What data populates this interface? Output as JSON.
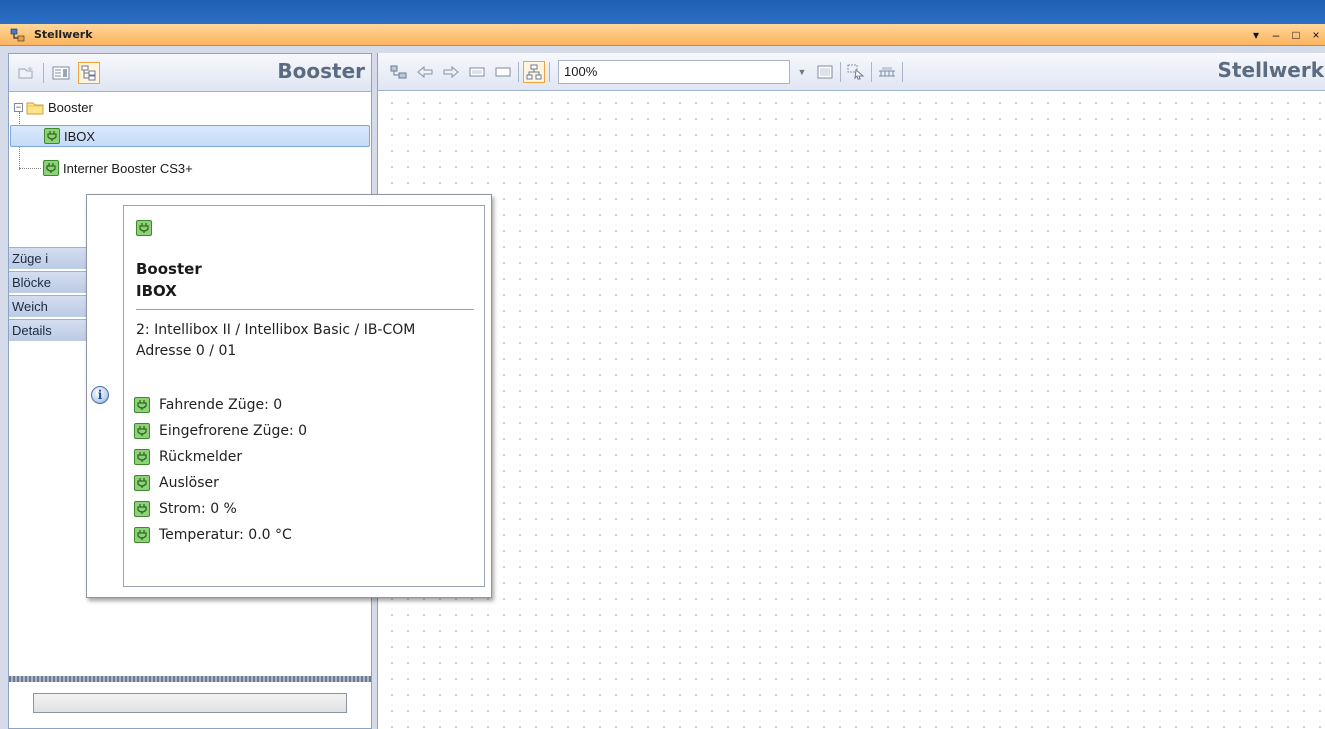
{
  "window": {
    "title": "Stellwerk",
    "controls": [
      "▾",
      "–",
      "□",
      "×"
    ]
  },
  "left_panel": {
    "title": "Booster",
    "tree": {
      "root": {
        "label": "Booster",
        "expander": "−"
      },
      "children": [
        {
          "label": "IBOX",
          "selected": true
        },
        {
          "label": "Interner Booster CS3+",
          "selected": false
        }
      ]
    },
    "accordion": [
      "Züge i",
      "Blöcke",
      "Weich",
      "Details"
    ],
    "bottom_input_value": ""
  },
  "right_panel": {
    "title": "Stellwerk",
    "zoom": "100%"
  },
  "tooltip": {
    "heading_line1": "Booster",
    "heading_line2": "IBOX",
    "desc_line1": "2: Intellibox II / Intellibox Basic / IB-COM",
    "desc_line2": "Adresse 0 / 01",
    "info_icon": "i",
    "items": [
      "Fahrende Züge: 0",
      "Eingefrorene Züge: 0",
      "Rückmelder",
      "Auslöser",
      "Strom: 0 %",
      "Temperatur: 0.0 °C"
    ]
  },
  "colors": {
    "titlebar": "#fbb45d",
    "selection": "#c4dbf7",
    "booster_icon": "#8fd07a",
    "accordion": "#bccbe4"
  }
}
